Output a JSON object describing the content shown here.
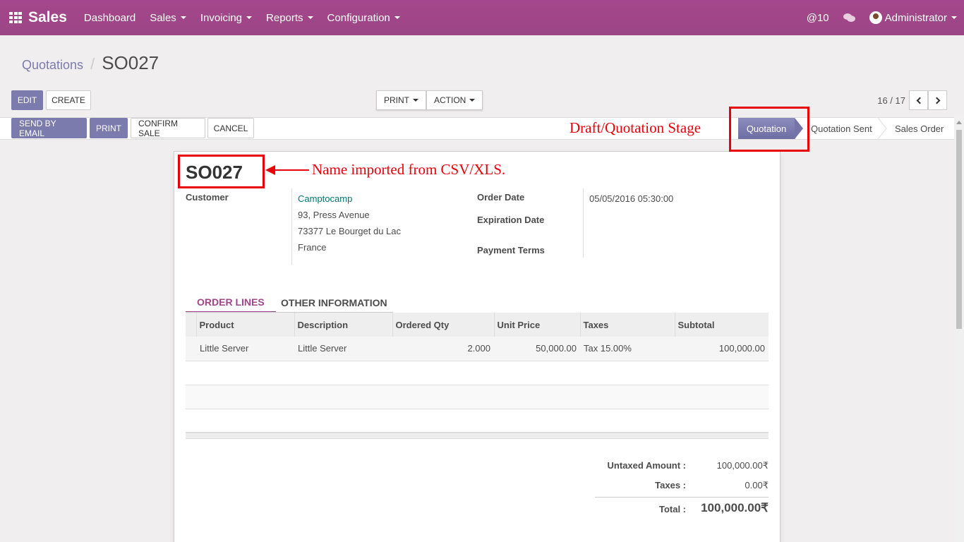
{
  "navbar": {
    "brand": "Sales",
    "menu": [
      "Dashboard",
      "Sales",
      "Invoicing",
      "Reports",
      "Configuration"
    ],
    "mentions": "@10",
    "user": "Administrator"
  },
  "breadcrumb": {
    "parent": "Quotations",
    "separator": "/",
    "current": "SO027"
  },
  "buttons": {
    "edit": "Edit",
    "create": "Create",
    "print_menu": "Print",
    "action_menu": "Action",
    "send_by_email": "Send by Email",
    "print": "Print",
    "confirm_sale": "Confirm Sale",
    "cancel": "Cancel"
  },
  "pager": {
    "value": "16 / 17"
  },
  "stages": {
    "quotation": "Quotation",
    "sent": "Quotation Sent",
    "order": "Sales Order"
  },
  "annotations": {
    "stage": "Draft/Quotation Stage",
    "name": "Name imported from CSV/XLS."
  },
  "form": {
    "name": "SO027",
    "customer_label": "Customer",
    "customer_name": "Camptocamp",
    "address": [
      "93, Press Avenue",
      "73377 Le Bourget du Lac",
      "France"
    ],
    "order_date_label": "Order Date",
    "order_date": "05/05/2016 05:30:00",
    "expiration_date_label": "Expiration Date",
    "payment_terms_label": "Payment Terms"
  },
  "tabs": {
    "order_lines": "Order Lines",
    "other_information": "Other Information"
  },
  "order_lines": {
    "columns": [
      "Product",
      "Description",
      "Ordered Qty",
      "Unit Price",
      "Taxes",
      "Subtotal"
    ],
    "rows": [
      {
        "product": "Little Server",
        "description": "Little Server",
        "qty": "2.000",
        "unit_price": "50,000.00",
        "taxes": "Tax 15.00%",
        "subtotal": "100,000.00"
      }
    ]
  },
  "totals": {
    "untaxed_label": "Untaxed Amount :",
    "untaxed": "100,000.00₹",
    "taxes_label": "Taxes :",
    "taxes": "0.00₹",
    "total_label": "Total :",
    "total": "100,000.00₹"
  },
  "colors": {
    "brand": "#a24689",
    "primary": "#7c7bad",
    "annotation": "#e8000b",
    "link": "#00766e"
  }
}
